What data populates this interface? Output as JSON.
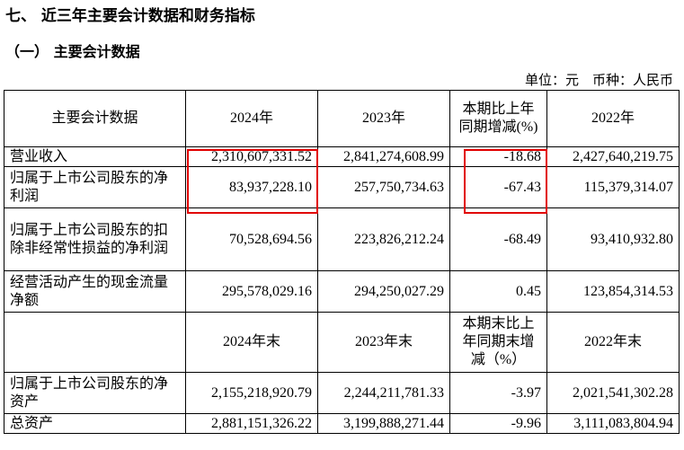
{
  "section_title": "七、 近三年主要会计数据和财务指标",
  "subsection_title": "（一） 主要会计数据",
  "unit_line": "单位：元　币种：人民币",
  "table": {
    "header": [
      "主要会计数据",
      "2024年",
      "2023年",
      "本期比上年同期增减(%)",
      "2022年"
    ],
    "rows": [
      [
        "营业收入",
        "2,310,607,331.52",
        "2,841,274,608.99",
        "-18.68",
        "2,427,640,219.75"
      ],
      [
        "归属于上市公司股东的净利润",
        "83,937,228.10",
        "257,750,734.63",
        "-67.43",
        "115,379,314.07"
      ],
      [
        "归属于上市公司股东的扣除非经常性损益的净利润",
        "70,528,694.56",
        "223,826,212.24",
        "-68.49",
        "93,410,932.80"
      ],
      [
        "经营活动产生的现金流量净额",
        "295,578,029.16",
        "294,250,027.29",
        "0.45",
        "123,854,314.53"
      ]
    ],
    "header2": [
      "",
      "2024年末",
      "2023年末",
      "本期末比上年同期末增减（%）",
      "2022年末"
    ],
    "rows2": [
      [
        "归属于上市公司股东的净资产",
        "2,155,218,920.79",
        "2,244,211,781.33",
        "-3.97",
        "2,021,541,302.28"
      ],
      [
        "总资产",
        "2,881,151,326.22",
        "3,199,888,271.44",
        "-9.96",
        "3,111,083,804.94"
      ]
    ]
  },
  "highlight_color": "#e10000"
}
